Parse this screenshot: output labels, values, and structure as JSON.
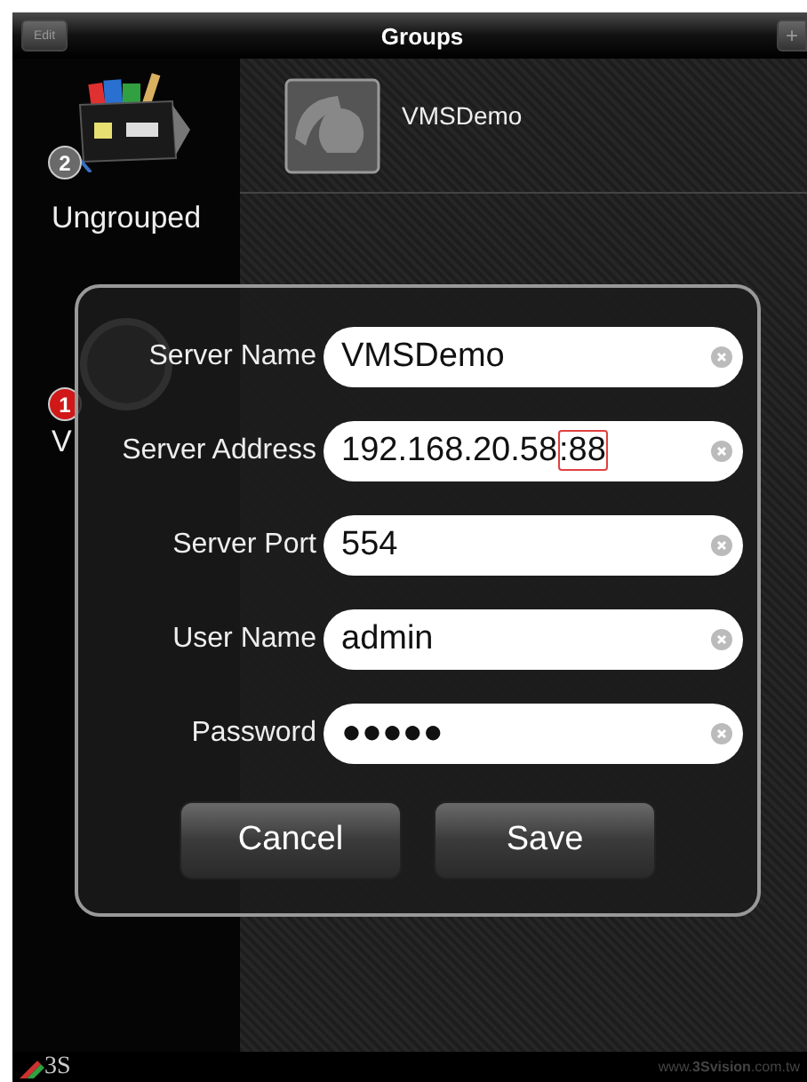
{
  "nav_bar": {
    "title": "Groups",
    "left_button": "Edit",
    "right_button": "+"
  },
  "sidebar": {
    "items": [
      {
        "kind": "box",
        "label": "Ungrouped",
        "badge": "2",
        "color": "#6a6a6a"
      },
      {
        "kind": "camera",
        "label": "V",
        "badge": "1",
        "color": "#d01818"
      }
    ]
  },
  "devices": [
    {
      "name": "VMSDemo"
    }
  ],
  "dialog": {
    "fields": [
      {
        "label": "Server Name",
        "value": "VMSDemo"
      },
      {
        "label": "Server Address",
        "value": "192.168.20.58",
        "highlighted_suffix": ":88"
      },
      {
        "label": "Server Port",
        "value": "554"
      },
      {
        "label": "User Name",
        "value": "admin"
      },
      {
        "label": "Password",
        "value": "●●●●●"
      }
    ],
    "buttons": [
      "Cancel",
      "Save"
    ]
  },
  "footer": {
    "logo": "3S",
    "website": "www.**3Svision**.com.tw"
  }
}
